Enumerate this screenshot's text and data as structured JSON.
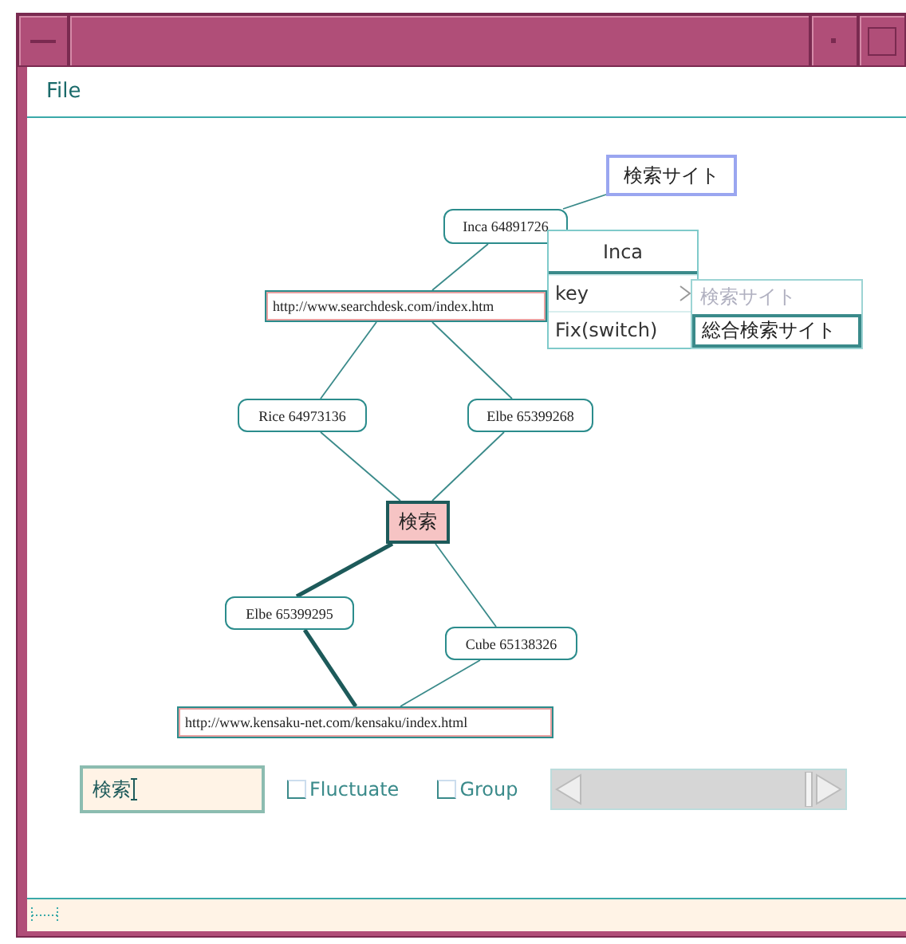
{
  "menu": [
    {
      "label": "File"
    }
  ],
  "graph": {
    "nodes": [
      {
        "label": "検索サイト",
        "kind": "site"
      },
      {
        "label": "Inca 64891726",
        "kind": "entry"
      },
      {
        "label": "http://www.searchdesk.com/index.htm",
        "kind": "url"
      },
      {
        "label": "Rice 64973136",
        "kind": "entry"
      },
      {
        "label": "Elbe 65399268",
        "kind": "entry"
      },
      {
        "label": "検索",
        "kind": "query"
      },
      {
        "label": "Elbe 65399295",
        "kind": "entry"
      },
      {
        "label": "Cube 65138326",
        "kind": "entry"
      },
      {
        "label": "http://www.kensaku-net.com/kensaku/index.html",
        "kind": "url"
      }
    ],
    "edges": [
      {
        "strong": false
      },
      {
        "strong": false
      },
      {
        "strong": false
      },
      {
        "strong": false
      },
      {
        "strong": false
      },
      {
        "strong": false
      },
      {
        "strong": true
      },
      {
        "strong": false
      },
      {
        "strong": true
      },
      {
        "strong": false
      }
    ]
  },
  "popup_menu": {
    "title": "Inca",
    "items": [
      {
        "label": "key",
        "submenu": true
      },
      {
        "label": "Fix(switch)",
        "submenu": false
      }
    ]
  },
  "submenu": [
    {
      "label": "検索サイト",
      "disabled": true,
      "selected": false
    },
    {
      "label": "総合検索サイト",
      "disabled": false,
      "selected": true
    }
  ],
  "search_field": {
    "value": "検索"
  },
  "checkboxes": [
    {
      "label": "Fluctuate",
      "checked": false
    },
    {
      "label": "Group",
      "checked": false
    }
  ]
}
